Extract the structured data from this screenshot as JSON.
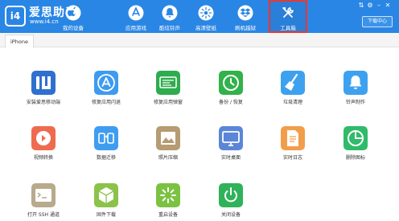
{
  "brand": {
    "logo": "i4",
    "name": "爱思助手",
    "url": "www.i4.cn"
  },
  "nav": [
    {
      "label": "我的设备",
      "icon": "apple-icon"
    },
    {
      "label": "应用游戏",
      "icon": "app-store-icon"
    },
    {
      "label": "酷炫铃声",
      "icon": "bell-icon"
    },
    {
      "label": "高清壁纸",
      "icon": "wallpaper-icon"
    },
    {
      "label": "刷机越狱",
      "icon": "dropbox-icon"
    },
    {
      "label": "工具箱",
      "icon": "toolbox-icon",
      "active": true
    }
  ],
  "window": {
    "download_label": "下载中心"
  },
  "tab": {
    "label": "iPhone"
  },
  "tools": [
    {
      "label": "安装爱思移动端",
      "icon": "i4-mobile-icon",
      "color": "#2f6fd0"
    },
    {
      "label": "修复应用闪退",
      "icon": "app-store-icon",
      "color": "#3d9bf0"
    },
    {
      "label": "修复应用弹窗",
      "icon": "apple-id-icon",
      "color": "#2eac4e"
    },
    {
      "label": "备份 / 恢复",
      "icon": "backup-icon",
      "color": "#31b24a"
    },
    {
      "label": "垃圾清理",
      "icon": "broom-icon",
      "color": "#3da1ef"
    },
    {
      "label": "铃声制作",
      "icon": "bell-icon",
      "color": "#3da1ef"
    },
    {
      "label": "视频转换",
      "icon": "video-icon",
      "color": "#ef6b4f"
    },
    {
      "label": "数据迁移",
      "icon": "migrate-icon",
      "color": "#3f9df0"
    },
    {
      "label": "照片压缩",
      "icon": "photo-icon",
      "color": "#b69b73"
    },
    {
      "label": "实时桌面",
      "icon": "monitor-icon",
      "color": "#5b86d8"
    },
    {
      "label": "实时日志",
      "icon": "log-icon",
      "color": "#f29d4a"
    },
    {
      "label": "删除图标",
      "icon": "pie-icon",
      "color": "#2fbb69"
    },
    {
      "label": "打开 SSH 通道",
      "icon": "terminal-icon",
      "color": "#b8aa8c"
    },
    {
      "label": "固件下载",
      "icon": "cube-icon",
      "color": "#8bc34a"
    },
    {
      "label": "重启设备",
      "icon": "restart-icon",
      "color": "#7cc242"
    },
    {
      "label": "关闭设备",
      "icon": "power-icon",
      "color": "#2fb25a"
    }
  ]
}
